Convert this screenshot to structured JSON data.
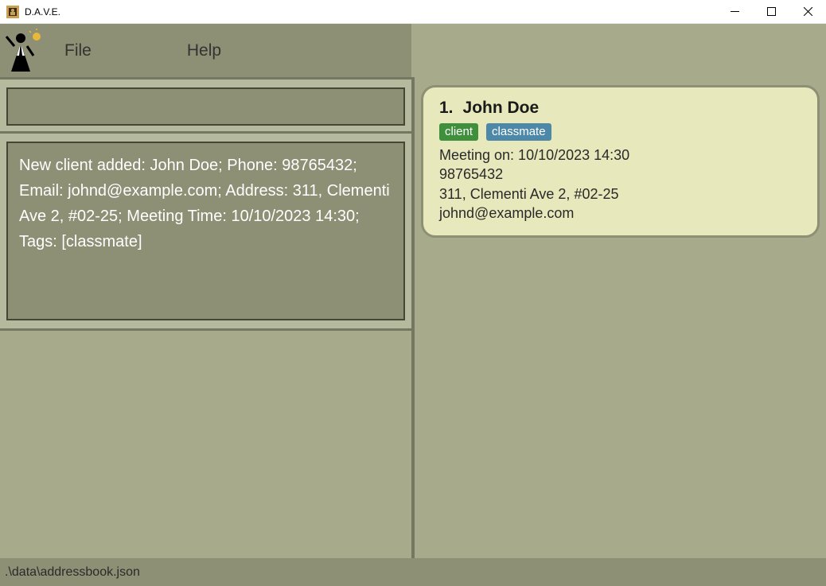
{
  "window": {
    "title": "D.A.V.E."
  },
  "menu": {
    "file": "File",
    "help": "Help"
  },
  "command": {
    "value": ""
  },
  "result": {
    "text": "New client added: John Doe; Phone: 98765432; Email: johnd@example.com; Address: 311, Clementi Ave 2, #02-25; Meeting Time: 10/10/2023 14:30; Tags: [classmate]"
  },
  "person": {
    "index": "1.",
    "name": "John Doe",
    "tags": [
      {
        "label": "client",
        "color": "green"
      },
      {
        "label": "classmate",
        "color": "blue"
      }
    ],
    "meeting": "Meeting on: 10/10/2023 14:30",
    "phone": "98765432",
    "address": "311, Clementi Ave 2, #02-25",
    "email": "johnd@example.com"
  },
  "status": {
    "path": ".\\data\\addressbook.json"
  }
}
